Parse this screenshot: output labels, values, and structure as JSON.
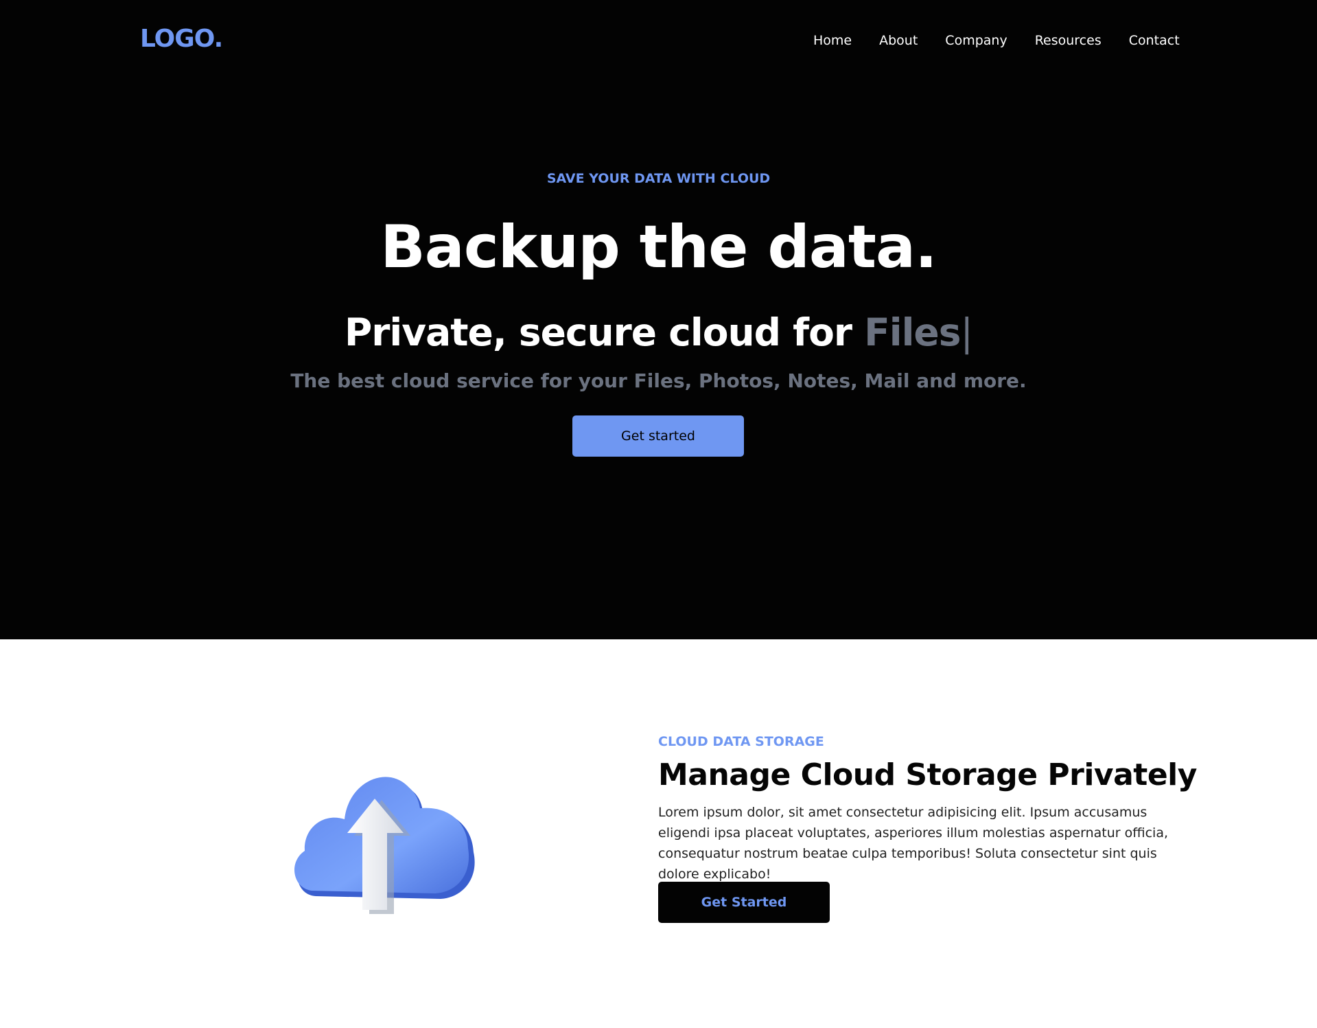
{
  "nav": {
    "logo": "LOGO.",
    "links": [
      "Home",
      "About",
      "Company",
      "Resources",
      "Contact"
    ]
  },
  "hero": {
    "kicker": "SAVE YOUR DATA WITH CLOUD",
    "title": "Backup the data.",
    "subtitle_prefix": "Private, secure cloud for ",
    "typed_word": "Files",
    "caret": "|",
    "description": "The best cloud service for your Files, Photos, Notes, Mail and more.",
    "cta_label": "Get started"
  },
  "feature": {
    "kicker": "CLOUD DATA STORAGE",
    "title": "Manage Cloud Storage Privately",
    "body": "Lorem ipsum dolor, sit amet consectetur adipisicing elit. Ipsum accusamus eligendi ipsa placeat voluptates, asperiores illum molestias aspernatur officia, consequatur nostrum beatae culpa temporibus! Soluta consectetur sint quis dolore explicabo!",
    "cta_label": "Get Started",
    "image_icon": "cloud-upload-icon"
  },
  "colors": {
    "accent": "#6f97f2",
    "hero_bg": "#030303",
    "muted": "#6b7280"
  }
}
